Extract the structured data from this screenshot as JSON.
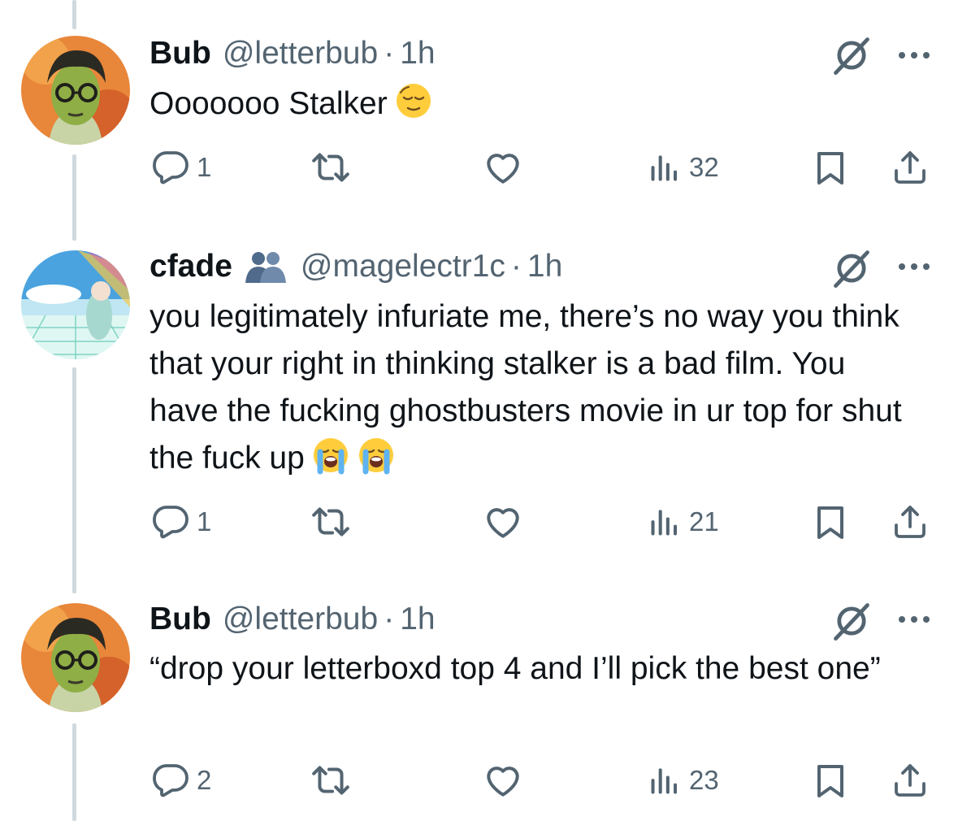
{
  "colors": {
    "text": "#0f1419",
    "secondary": "#536471",
    "thread_line": "#cfd9de",
    "background": "#ffffff"
  },
  "tweets": [
    {
      "name": "Bub",
      "handle": "@letterbub",
      "separator": "·",
      "time": "1h",
      "text": "Ooooooo Stalker",
      "emojis": [
        "relieved-face-emoji"
      ],
      "replies": "1",
      "views": "32"
    },
    {
      "name": "cfade",
      "affiliation_icon": "two-people-hugging-icon",
      "handle": "@magelectr1c",
      "separator": "·",
      "time": "1h",
      "text": "you legitimately infuriate me, there’s no way you think that your right in thinking stalker is a bad film. You have the fucking ghostbusters movie in ur top for shut the fuck up",
      "emojis": [
        "loudly-crying-face-emoji",
        "loudly-crying-face-emoji"
      ],
      "replies": "1",
      "views": "21"
    },
    {
      "name": "Bub",
      "handle": "@letterbub",
      "separator": "·",
      "time": "1h",
      "text": "“drop your letterboxd top 4 and I’ll pick the best one”",
      "emojis": [],
      "replies": "2",
      "views": "23"
    }
  ],
  "icons": [
    "grok-icon",
    "more-icon",
    "reply-icon",
    "repost-icon",
    "like-icon",
    "views-icon",
    "bookmark-icon",
    "share-icon"
  ]
}
